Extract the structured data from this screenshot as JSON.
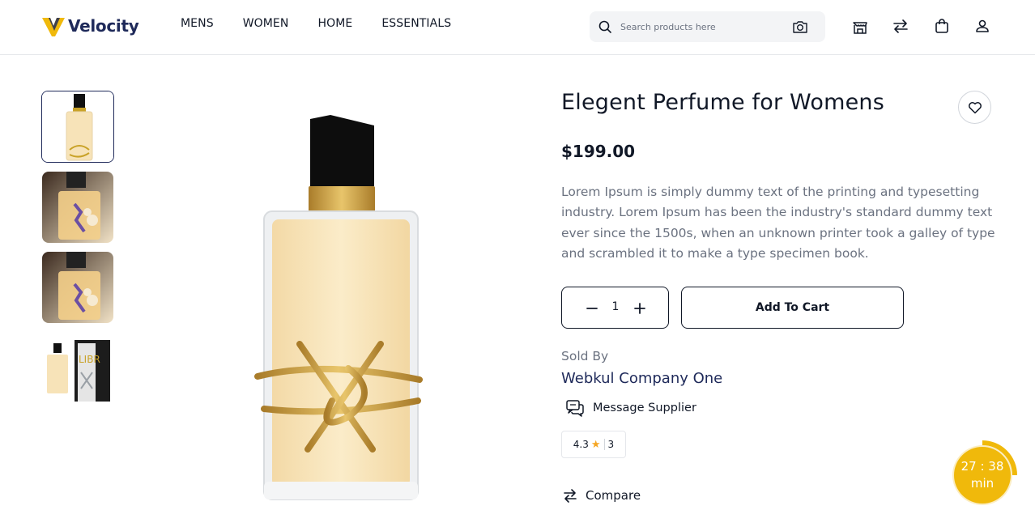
{
  "brand": {
    "name": "Velocity",
    "accent": "#f0b90b",
    "primary": "#1f2a5a"
  },
  "nav": {
    "items": [
      "MENS",
      "WOMEN",
      "HOME",
      "ESSENTIALS"
    ]
  },
  "search": {
    "placeholder": "Search products here",
    "icon": "search-icon",
    "camera": "camera-icon"
  },
  "header_icons": [
    "store-icon",
    "compare-arrows-icon",
    "shopping-bag-icon",
    "user-icon"
  ],
  "product": {
    "title": "Elegent Perfume for Womens",
    "price": "$199.00",
    "description": "Lorem Ipsum is simply dummy text of the printing and typesetting industry. Lorem Ipsum has been the industry's standard dummy text ever since the 1500s, when an unknown printer took a galley of type and scrambled it to make a type specimen book.",
    "quantity": "1",
    "add_to_cart": "Add To Cart",
    "sold_by_label": "Sold By",
    "seller": "Webkul Company One",
    "message_supplier": "Message Supplier",
    "rating": "4.3",
    "review_count": "3",
    "compare": "Compare",
    "thumbnails": [
      "perfume-bottle",
      "perfume-with-flowers",
      "perfume-with-flowers",
      "perfume-with-box"
    ]
  },
  "timer": {
    "value": "27 : 38",
    "unit": "min"
  }
}
